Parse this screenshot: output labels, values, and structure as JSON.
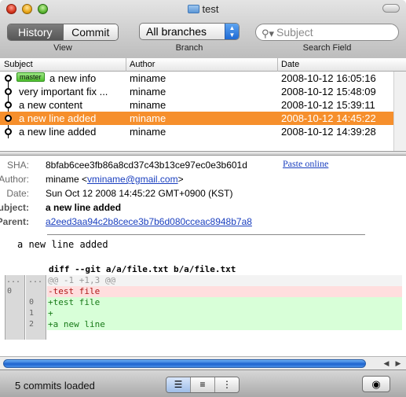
{
  "window": {
    "title": "test"
  },
  "toolbar": {
    "view_tabs": [
      "History",
      "Commit"
    ],
    "view_label": "View",
    "branch_value": "All branches",
    "branch_label": "Branch",
    "search_placeholder": "Subject",
    "search_label": "Search Field"
  },
  "list": {
    "columns": [
      "Subject",
      "Author",
      "Date"
    ],
    "commits": [
      {
        "tag": "master",
        "subject": "a new info",
        "author": "miname",
        "date": "2008-10-12 16:05:16",
        "selected": false
      },
      {
        "tag": "",
        "subject": "very important fix ...",
        "author": "miname",
        "date": "2008-10-12 15:48:09",
        "selected": false
      },
      {
        "tag": "",
        "subject": "a new content",
        "author": "miname",
        "date": "2008-10-12 15:39:11",
        "selected": false
      },
      {
        "tag": "",
        "subject": "a new line added",
        "author": "miname",
        "date": "2008-10-12 14:45:22",
        "selected": true
      },
      {
        "tag": "",
        "subject": "a new line added",
        "author": "miname",
        "date": "2008-10-12 14:39:28",
        "selected": false
      }
    ]
  },
  "detail": {
    "sha_label": "SHA:",
    "sha": "8bfab6cee3fb86a8cd37c43b13ce97ec0e3b601d",
    "paste_online": "Paste online",
    "author_label": "Author:",
    "author_name": "miname <",
    "author_email": "vminame@gmail.com",
    "author_tail": ">",
    "date_label": "Date:",
    "date": "Sun Oct 12 2008 14:45:22 GMT+0900 (KST)",
    "subject_label": "Subject:",
    "subject": "a new line added",
    "parent_label": "Parent:",
    "parent": "a2eed3aa94c2b8cece3b7b6d080cceac8948b7a8",
    "message": "a new line added"
  },
  "diff": {
    "header": "diff --git a/a/file.txt b/a/file.txt",
    "lines": [
      {
        "kind": "hunk",
        "text": "@@ -1 +1,3 @@",
        "old": "...",
        "new": "..."
      },
      {
        "kind": "del",
        "text": "-test file",
        "old": "0",
        "new": ""
      },
      {
        "kind": "add",
        "text": "+test file",
        "old": "",
        "new": "0"
      },
      {
        "kind": "add",
        "text": "+",
        "old": "",
        "new": "1"
      },
      {
        "kind": "add",
        "text": "+a new line",
        "old": "",
        "new": "2"
      }
    ]
  },
  "status": {
    "text": "5 commits loaded",
    "view_icons": [
      "list-detail-icon",
      "list-icon",
      "tree-icon"
    ],
    "eye_icon": "eye-icon"
  },
  "colors": {
    "selection": "#f68f2c",
    "master_tag": "#5ec43c",
    "link": "#1a3fbf",
    "diff_add_bg": "#d8ffd8",
    "diff_del_bg": "#ffdede"
  }
}
